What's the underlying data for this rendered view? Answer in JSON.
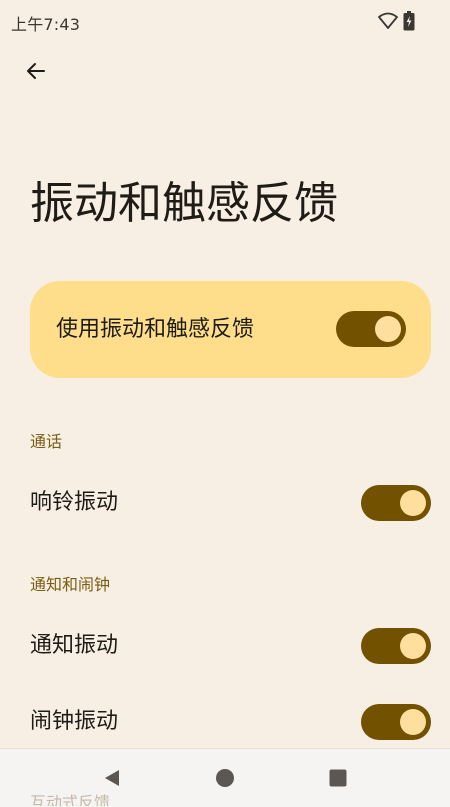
{
  "status_bar": {
    "time": "上午7:43",
    "icons": [
      "wifi-icon",
      "battery-charging-icon"
    ]
  },
  "header": {
    "back_icon": "arrow-back-icon",
    "title": "振动和触感反馈"
  },
  "main_toggle": {
    "label": "使用振动和触感反馈",
    "checked": true
  },
  "sections": [
    {
      "header": "通话",
      "items": [
        {
          "label": "响铃振动",
          "checked": true
        }
      ]
    },
    {
      "header": "通知和闹钟",
      "items": [
        {
          "label": "通知振动",
          "checked": true
        },
        {
          "label": "闹钟振动",
          "checked": true
        }
      ]
    },
    {
      "header": "互动式反馈",
      "items": []
    }
  ],
  "nav_bar": {
    "buttons": [
      "back-triangle-icon",
      "home-circle-icon",
      "recents-square-icon"
    ]
  },
  "colors": {
    "background": "#F7EFE4",
    "card": "#FEDE8A",
    "toggle_track": "#725100",
    "toggle_knob": "#FFDF9E",
    "section_header": "#7A5E10",
    "nav_bar": "#F6F4F2"
  }
}
